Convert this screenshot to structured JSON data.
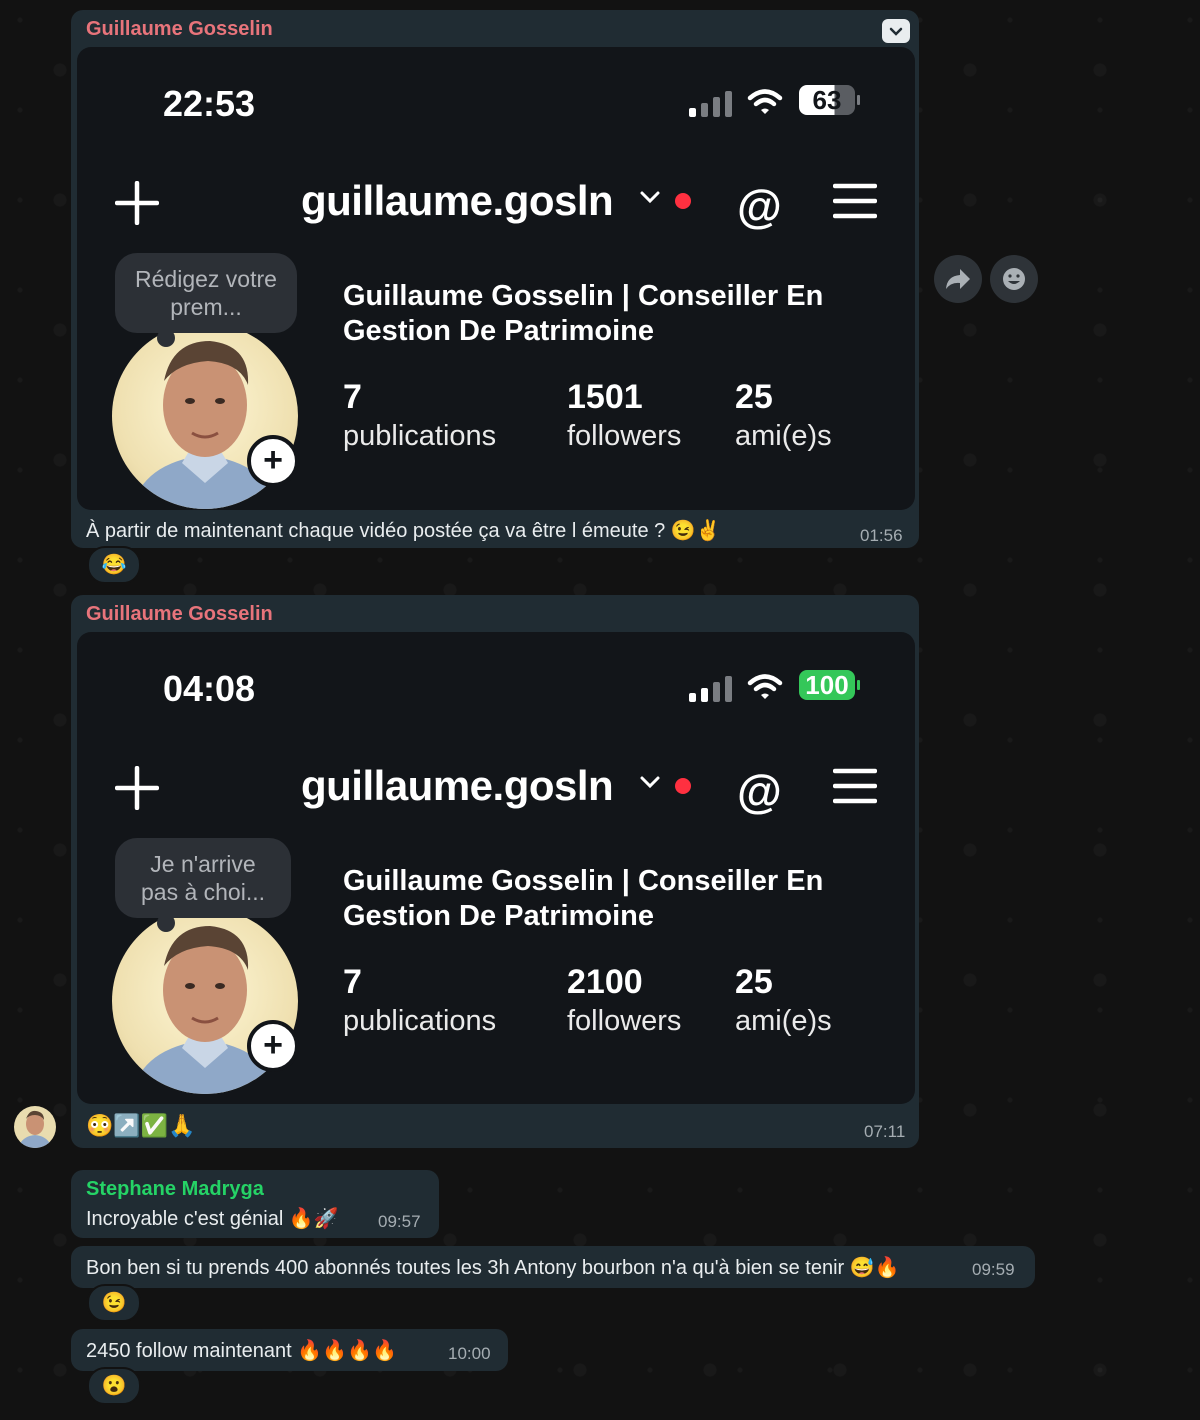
{
  "messages": [
    {
      "sender": "Guillaume Gosselin",
      "screenshot": {
        "clock": "22:53",
        "battery": "63",
        "username": "guillaume.gosln",
        "note": "Rédigez votre prem...",
        "profile_name": "Guillaume Gosselin | Conseiller En Gestion De Patrimoine",
        "stats": [
          {
            "value": "7",
            "label": "publications"
          },
          {
            "value": "1501",
            "label": "followers"
          },
          {
            "value": "25",
            "label": "ami(e)s"
          }
        ]
      },
      "text": "À partir de maintenant chaque vidéo postée ça va être l émeute ? 😉✌️",
      "time": "01:56",
      "reactions": "😂"
    },
    {
      "sender": "Guillaume Gosselin",
      "screenshot": {
        "clock": "04:08",
        "battery": "100",
        "username": "guillaume.gosln",
        "note": "Je n'arrive pas à choi...",
        "profile_name": "Guillaume Gosselin | Conseiller En Gestion De Patrimoine",
        "stats": [
          {
            "value": "7",
            "label": "publications"
          },
          {
            "value": "2100",
            "label": "followers"
          },
          {
            "value": "25",
            "label": "ami(e)s"
          }
        ]
      },
      "text": "😳↗️✅🙏",
      "time": "07:11"
    },
    {
      "sender": "Stephane Madryga",
      "text": "Incroyable c'est génial 🔥🚀",
      "time": "09:57"
    },
    {
      "text": "Bon ben si tu prends 400 abonnés toutes les 3h Antony bourbon n'a qu'à bien se tenir 😅🔥",
      "time": "09:59",
      "reactions": "😉"
    },
    {
      "text": "2450 follow maintenant 🔥🔥🔥🔥",
      "time": "10:00",
      "reactions": "😮"
    }
  ],
  "colors": {
    "sender_guillaume": "#e8747b",
    "sender_stephane": "#25d366",
    "bubble": "#202c33",
    "battery_full": "#34c759"
  },
  "icons": [
    "chevron-down-icon",
    "forward-icon",
    "emoji-react-icon",
    "signal-icon",
    "wifi-icon",
    "battery-icon",
    "plus-icon",
    "threads-icon",
    "menu-icon",
    "avatar"
  ]
}
